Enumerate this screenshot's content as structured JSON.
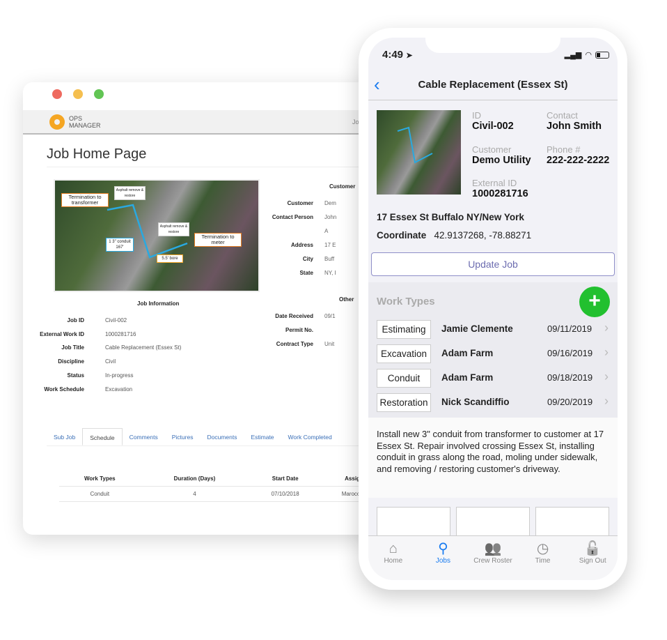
{
  "desktop": {
    "logo": [
      "OPS",
      "MANAGER"
    ],
    "header_link": "Jo",
    "title": "Job Home Page",
    "map_labels": [
      "Termination to transformer",
      "Asphalt remove & restore",
      "Asphalt remove & restore",
      "1 3\" conduit 167'",
      "Termination to meter",
      "5.5' bore"
    ],
    "job_info_title": "Job Information",
    "job_info": [
      {
        "k": "Job ID",
        "v": "Civil-002"
      },
      {
        "k": "External Work ID",
        "v": "1000281716"
      },
      {
        "k": "Job Title",
        "v": "Cable Replacement (Essex St)"
      },
      {
        "k": "Discipline",
        "v": "Civil"
      },
      {
        "k": "Status",
        "v": "In-progress"
      },
      {
        "k": "Work Schedule",
        "v": "Excavation"
      }
    ],
    "customer_title": "Customer",
    "customer": [
      {
        "k": "Customer",
        "v": "Dem"
      },
      {
        "k": "Contact Person",
        "v": "John"
      },
      {
        "k": "",
        "v": "A"
      },
      {
        "k": "Address",
        "v": "17 E"
      },
      {
        "k": "City",
        "v": "Buff"
      },
      {
        "k": "State",
        "v": "NY, I"
      }
    ],
    "other_title": "Other",
    "other": [
      {
        "k": "Date Received",
        "v": "09/1"
      },
      {
        "k": "Permit No.",
        "v": ""
      },
      {
        "k": "Contract Type",
        "v": "Unit"
      }
    ],
    "tabs": [
      "Sub Job",
      "Schedule",
      "Comments",
      "Pictures",
      "Documents",
      "Estimate",
      "Work Completed"
    ],
    "active_tab": "Schedule",
    "table": {
      "headers": [
        "Work Types",
        "Duration (Days)",
        "Start Date",
        "Assign"
      ],
      "rows": [
        [
          "Conduit",
          "4",
          "07/10/2018",
          "Marocoo I"
        ]
      ]
    }
  },
  "phone": {
    "time": "4:49",
    "title": "Cable Replacement (Essex St)",
    "fields": [
      {
        "k": "ID",
        "v": "Civil-002"
      },
      {
        "k": "Contact",
        "v": "John Smith"
      },
      {
        "k": "Customer",
        "v": "Demo Utility"
      },
      {
        "k": "Phone #",
        "v": "222-222-2222"
      },
      {
        "k": "External ID",
        "v": "1000281716"
      }
    ],
    "address": "17 Essex St Buffalo NY/New York",
    "coord_label": "Coordinate",
    "coord": "42.9137268, -78.88271",
    "update_label": "Update Job",
    "work_types_title": "Work Types",
    "work_types": [
      {
        "type": "Estimating",
        "person": "Jamie Clemente",
        "date": "09/11/2019"
      },
      {
        "type": "Excavation",
        "person": "Adam Farm",
        "date": "09/16/2019"
      },
      {
        "type": "Conduit",
        "person": "Adam Farm",
        "date": "09/18/2019"
      },
      {
        "type": "Restoration",
        "person": "Nick Scandiffio",
        "date": "09/20/2019"
      }
    ],
    "description": "Install new 3\" conduit from transformer to customer at 17 Essex St. Repair involved crossing Essex St, installing conduit in grass along the road, moling under sidewalk, and removing / restoring customer's driveway.",
    "tabs": [
      {
        "label": "Home",
        "icon": "house-icon"
      },
      {
        "label": "Jobs",
        "icon": "search-icon"
      },
      {
        "label": "Crew Roster",
        "icon": "people-icon"
      },
      {
        "label": "Time",
        "icon": "clock-icon"
      },
      {
        "label": "Sign Out",
        "icon": "unlock-icon"
      }
    ],
    "active_tab": "Jobs",
    "accent": "#1a7cf0",
    "add_color": "#22c02f"
  }
}
